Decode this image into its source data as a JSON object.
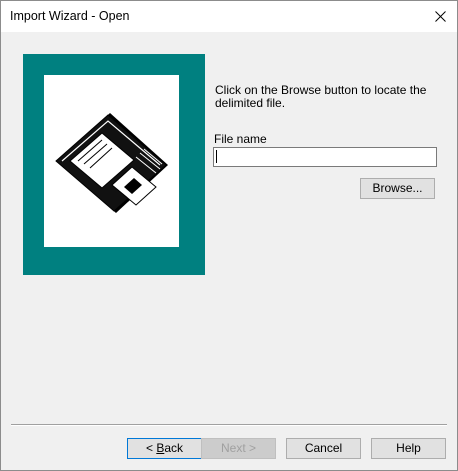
{
  "window": {
    "title": "Import Wizard - Open"
  },
  "illustration": {
    "icon": "floppy-disk-icon",
    "frame_color": "#008080"
  },
  "main": {
    "instructions": "Click on the Browse button to locate the delimited file.",
    "file_name_label": "File name",
    "file_name_value": "",
    "browse_label": "Browse..."
  },
  "footer": {
    "back_prefix": "< ",
    "back_accel": "B",
    "back_rest": "ack",
    "next_label": "Next >",
    "cancel_label": "Cancel",
    "help_label": "Help"
  }
}
